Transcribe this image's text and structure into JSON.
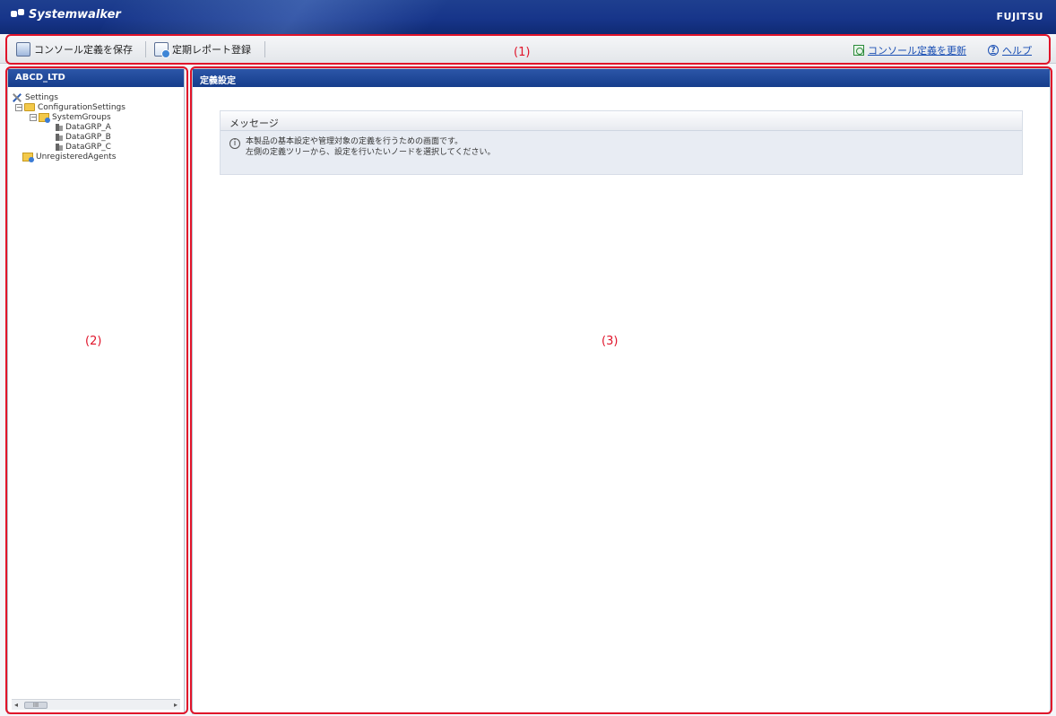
{
  "titlebar": {
    "brand": "Systemwalker",
    "vendor": "FUJITSU"
  },
  "toolbar": {
    "save_label": "コンソール定義を保存",
    "report_label": "定期レポート登録",
    "update_label": "コンソール定義を更新",
    "help_label": "ヘルプ"
  },
  "annotations": {
    "toolbar": "(1)",
    "tree": "(2)",
    "main": "(3)"
  },
  "left_panel": {
    "title": "ABCD_LTD",
    "tree": {
      "settings": "Settings",
      "configuration": "ConfigurationSettings",
      "system_groups": "SystemGroups",
      "nodes": [
        "DataGRP_A",
        "DataGRP_B",
        "DataGRP_C"
      ],
      "unregistered": "UnregisteredAgents"
    },
    "scroll_thumb": "III"
  },
  "main_panel": {
    "title": "定義設定",
    "message": {
      "heading": "メッセージ",
      "line1": "本製品の基本設定や管理対象の定義を行うための画面です。",
      "line2": "左側の定義ツリーから、設定を行いたいノードを選択してください。"
    }
  }
}
